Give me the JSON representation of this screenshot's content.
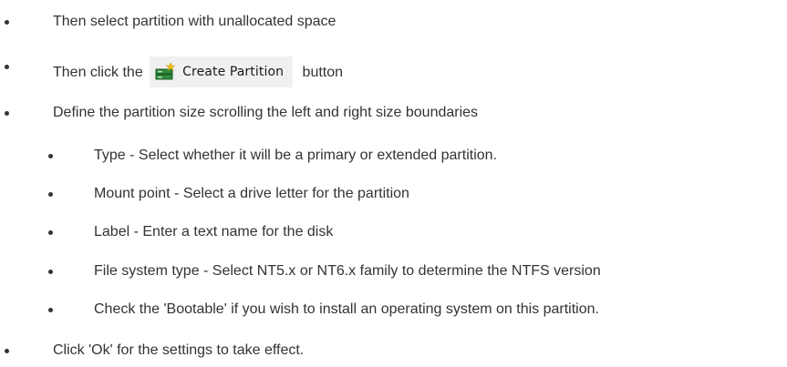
{
  "steps": [
    {
      "text": "Then select partition with unallocated space"
    },
    {
      "prefix": "Then click the",
      "button_label": "Create Partition",
      "button_icon": "create-partition-icon",
      "suffix": "button"
    },
    {
      "text": "Define the partition size scrolling the left and right size boundaries",
      "sub_items": [
        "Type - Select whether it will be a primary or extended partition.",
        "Mount point - Select a drive letter for the partition",
        "Label - Enter a text name for the disk",
        "File system type - Select NT5.x or NT6.x family to determine the NTFS version",
        "Check the 'Bootable' if you wish to install an operating system on this partition."
      ]
    },
    {
      "text": "Click 'Ok' for the settings to take effect."
    }
  ],
  "colors": {
    "text": "#333333",
    "button_background": "#f0f0f0",
    "icon_green": "#2e8b3a",
    "icon_star": "#f2c40f"
  }
}
